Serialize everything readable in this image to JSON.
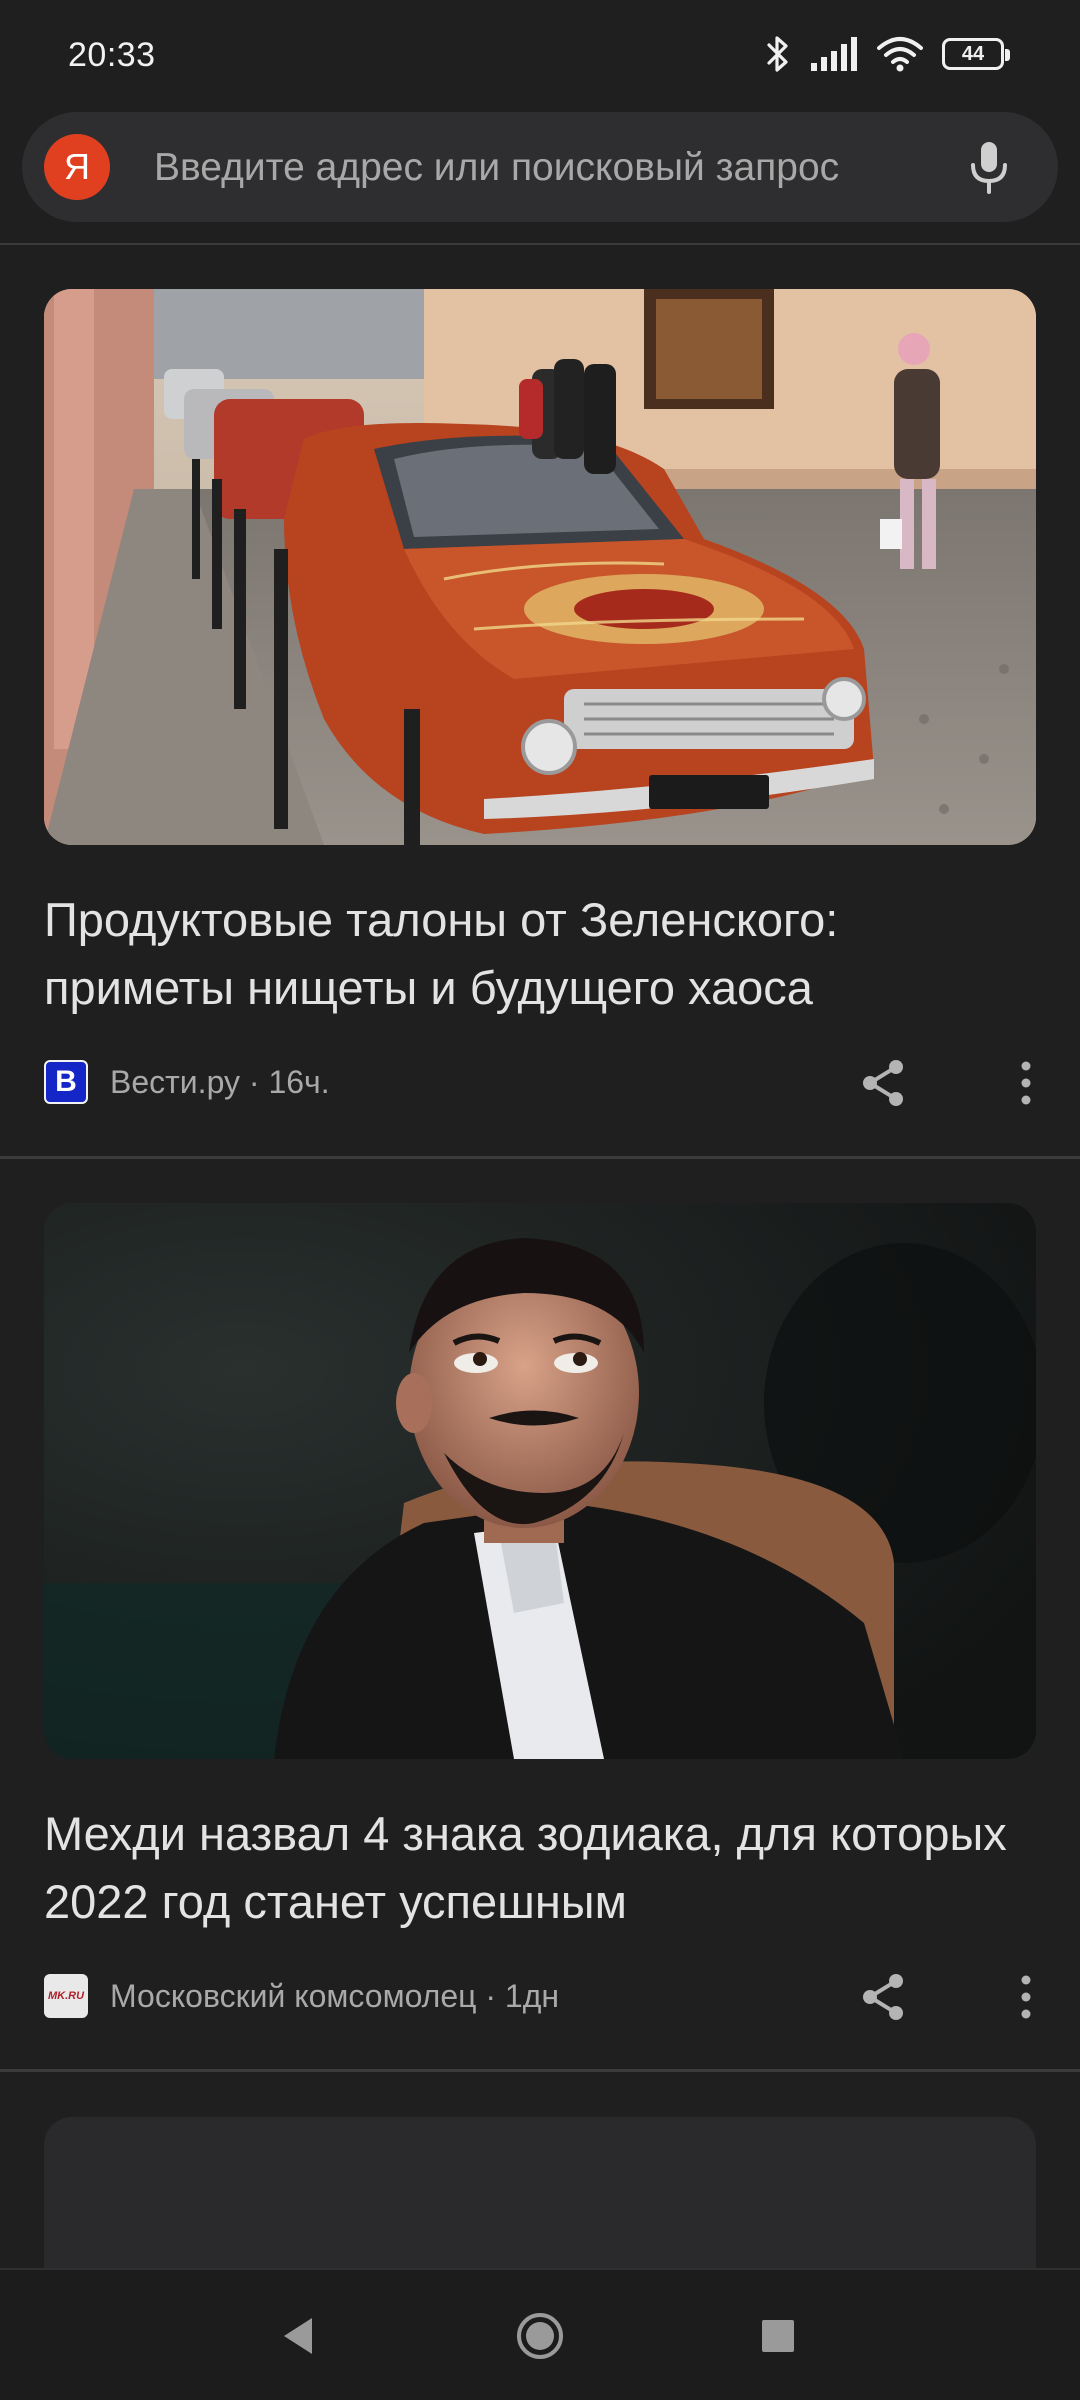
{
  "status_bar": {
    "time": "20:33",
    "battery_level": "44",
    "icons": [
      "bluetooth-icon",
      "signal-icon",
      "wifi-icon",
      "battery-icon"
    ]
  },
  "search": {
    "logo_letter": "Я",
    "placeholder": "Введите адрес или поисковый запрос",
    "mic_icon": "microphone-icon"
  },
  "feed": [
    {
      "title": "Продуктовые талоны от Зеленского: приметы нищеты и будущего хаоса",
      "source_logo_letter": "В",
      "source_logo_color": "#1526c7",
      "source": "Вести.ру · 16ч.",
      "image_subject": "carpet-covered car on cobblestone street"
    },
    {
      "title": "Мехди назвал 4 знака зодиака, для которых 2022 год станет успешным",
      "source_logo_letter": "MK.RU",
      "source_logo_color": "#e9e9e9",
      "source": "Московский комсомолец · 1дн",
      "image_subject": "bearded man in dark suit looking upward"
    }
  ],
  "colors": {
    "background": "#1f1f1f",
    "search_bg": "#2e2e30",
    "yandex_red": "#e0401f",
    "text_primary": "#e3e3e3",
    "text_secondary": "#a9a9a9"
  },
  "nav": {
    "back_icon": "back-triangle-icon",
    "home_icon": "home-circle-icon",
    "recent_icon": "recent-square-icon"
  }
}
